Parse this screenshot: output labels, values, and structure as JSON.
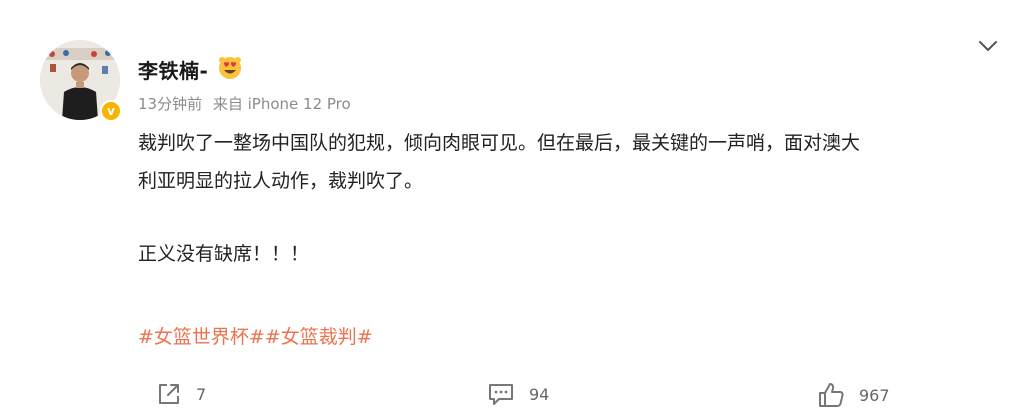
{
  "user": {
    "name": "李铁楠-",
    "time": "13分钟前",
    "source": "来自 iPhone 12 Pro",
    "badge": "v"
  },
  "post": {
    "line1": "裁判吹了一整场中国队的犯规，倾向肉眼可见。但在最后，最关键的一声哨，面对澳大",
    "line2": "利亚明显的拉人动作，裁判吹了。",
    "para2": "正义没有缺席！！！",
    "tags": [
      "#女篮世界杯#",
      "#女篮裁判#"
    ]
  },
  "actions": {
    "share": "7",
    "comment": "94",
    "like": "967"
  },
  "colors": {
    "accent": "#eb7350",
    "verified": "#f7b500",
    "meta": "#8c8c8c"
  },
  "icons": [
    "chevron-down-icon",
    "heart-eyes-emoji-icon",
    "share-icon",
    "comment-icon",
    "like-icon"
  ]
}
